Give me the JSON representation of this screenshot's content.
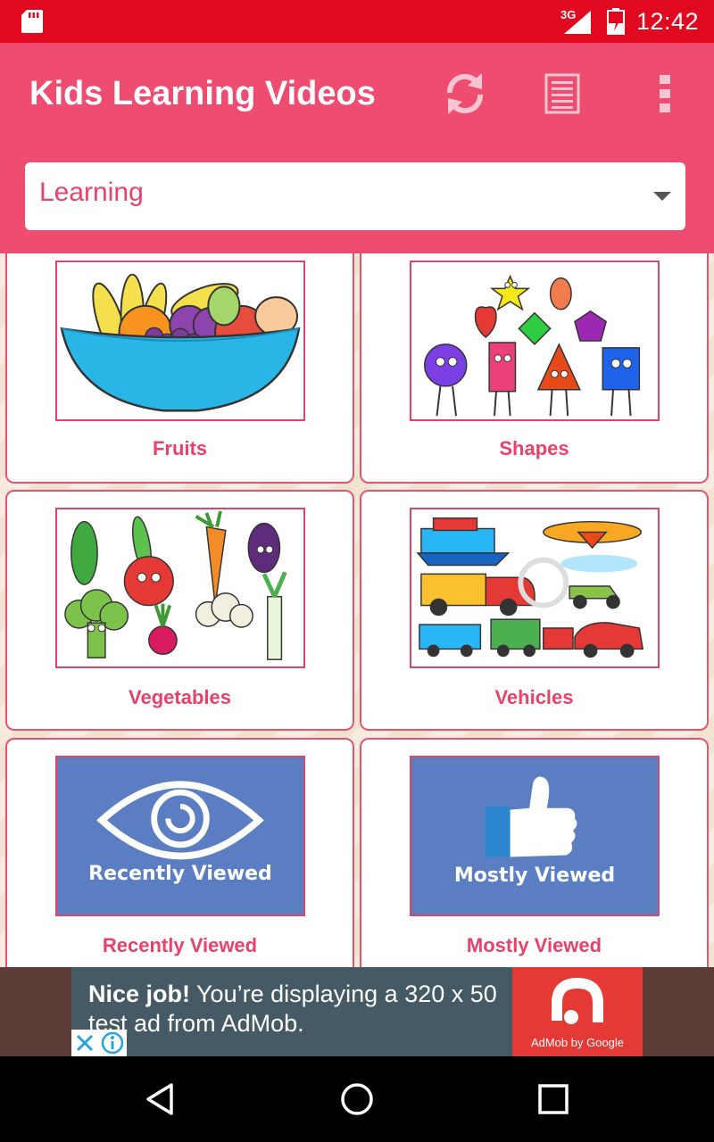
{
  "status_bar": {
    "network_label": "3G",
    "time": "12:42",
    "icons": [
      "sd-card-icon",
      "signal-icon",
      "battery-icon"
    ]
  },
  "app_bar": {
    "title": "Kids Learning Videos",
    "actions": [
      "refresh-icon",
      "list-icon",
      "more-vert-icon"
    ],
    "background": "#ef4c72"
  },
  "category_select": {
    "value": "Learning"
  },
  "categories": [
    {
      "label": "Fruits"
    },
    {
      "label": "Shapes"
    },
    {
      "label": "Vegetables"
    },
    {
      "label": "Vehicles"
    },
    {
      "label": "Recently Viewed",
      "thumb_text": "Recently Viewed"
    },
    {
      "label": "Mostly Viewed",
      "thumb_text": "Mostly Viewed"
    }
  ],
  "ad": {
    "headline": "Nice job!",
    "body": "You’re displaying a 320 x 50 test ad from AdMob.",
    "brand": "AdMob by Google"
  },
  "nav_bar": {
    "buttons": [
      "back-icon",
      "home-icon",
      "recents-icon"
    ]
  },
  "colors": {
    "status_bar": "#e1091f",
    "accent": "#e8426a",
    "tile_blue": "#5b7ec2",
    "ad_red": "#e53935"
  }
}
